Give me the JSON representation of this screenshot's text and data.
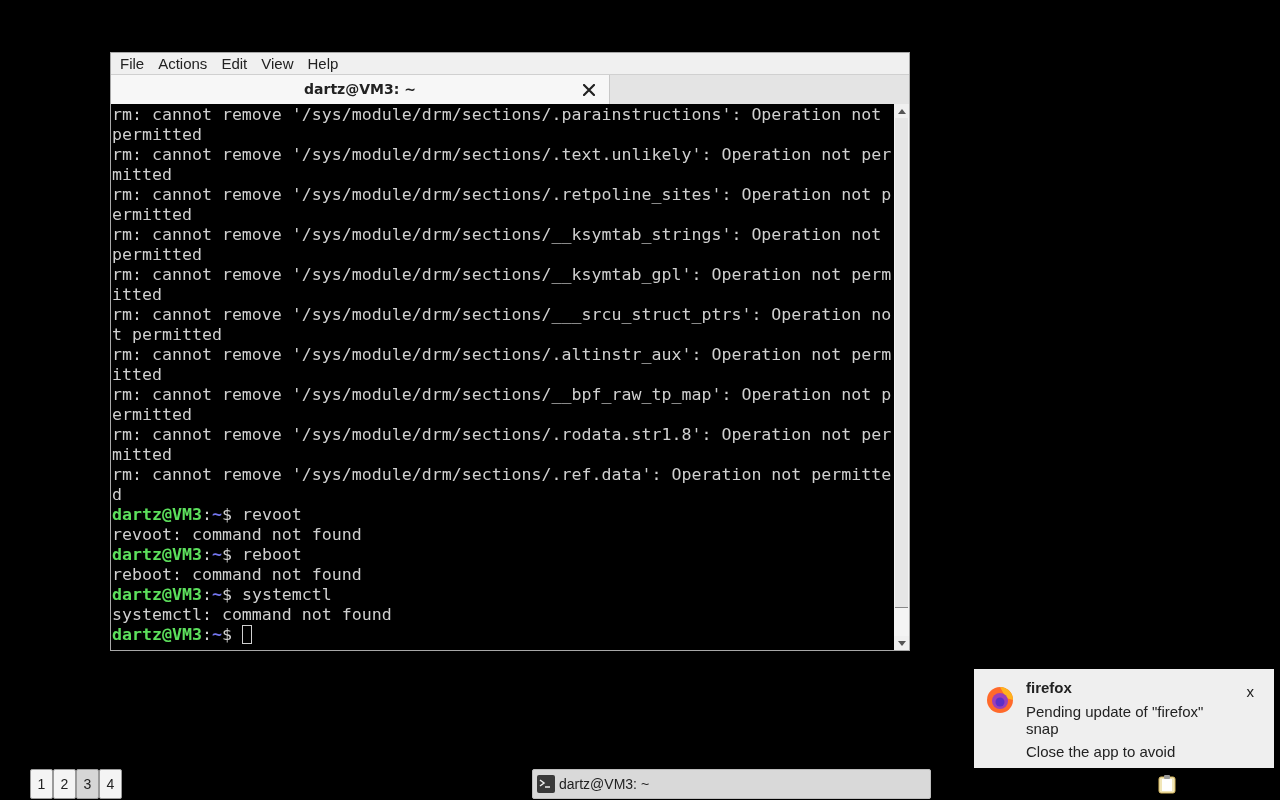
{
  "terminal_window": {
    "menu": [
      "File",
      "Actions",
      "Edit",
      "View",
      "Help"
    ],
    "tabs": [
      {
        "title": "dartz@VM3: ~",
        "selected": true
      }
    ],
    "lines": [
      {
        "kind": "output",
        "text": "rm: cannot remove '/sys/module/drm/sections/.parainstructions': Operation not permitted"
      },
      {
        "kind": "output",
        "text": "rm: cannot remove '/sys/module/drm/sections/.text.unlikely': Operation not permitted"
      },
      {
        "kind": "output",
        "text": "rm: cannot remove '/sys/module/drm/sections/.retpoline_sites': Operation not permitted"
      },
      {
        "kind": "output",
        "text": "rm: cannot remove '/sys/module/drm/sections/__ksymtab_strings': Operation not permitted"
      },
      {
        "kind": "output",
        "text": "rm: cannot remove '/sys/module/drm/sections/__ksymtab_gpl': Operation not permitted"
      },
      {
        "kind": "output",
        "text": "rm: cannot remove '/sys/module/drm/sections/___srcu_struct_ptrs': Operation not permitted"
      },
      {
        "kind": "output",
        "text": "rm: cannot remove '/sys/module/drm/sections/.altinstr_aux': Operation not permitted"
      },
      {
        "kind": "output",
        "text": "rm: cannot remove '/sys/module/drm/sections/__bpf_raw_tp_map': Operation not permitted"
      },
      {
        "kind": "output",
        "text": "rm: cannot remove '/sys/module/drm/sections/.rodata.str1.8': Operation not permitted"
      },
      {
        "kind": "output",
        "text": "rm: cannot remove '/sys/module/drm/sections/.ref.data': Operation not permitted"
      },
      {
        "kind": "prompt",
        "user_host": "dartz@VM3",
        "colon": ":",
        "cwd": "~",
        "sign": "$",
        "command": "revoot",
        "cursor": false
      },
      {
        "kind": "output",
        "text": "revoot: command not found"
      },
      {
        "kind": "prompt",
        "user_host": "dartz@VM3",
        "colon": ":",
        "cwd": "~",
        "sign": "$",
        "command": "reboot",
        "cursor": false
      },
      {
        "kind": "output",
        "text": "reboot: command not found"
      },
      {
        "kind": "prompt",
        "user_host": "dartz@VM3",
        "colon": ":",
        "cwd": "~",
        "sign": "$",
        "command": "systemctl",
        "cursor": false
      },
      {
        "kind": "output",
        "text": "systemctl: command not found"
      },
      {
        "kind": "prompt",
        "user_host": "dartz@VM3",
        "colon": ":",
        "cwd": "~",
        "sign": "$",
        "cursor": true
      }
    ]
  },
  "notification": {
    "title": "firefox",
    "body": "Pending update of \"firefox\" snap",
    "detail": "Close the app to avoid",
    "close": "x"
  },
  "taskbar": {
    "workspaces": [
      {
        "label": "1",
        "selected": false
      },
      {
        "label": "2",
        "selected": false
      },
      {
        "label": "3",
        "selected": true
      },
      {
        "label": "4",
        "selected": false
      }
    ],
    "task": {
      "title": "dartz@VM3: ~"
    }
  }
}
